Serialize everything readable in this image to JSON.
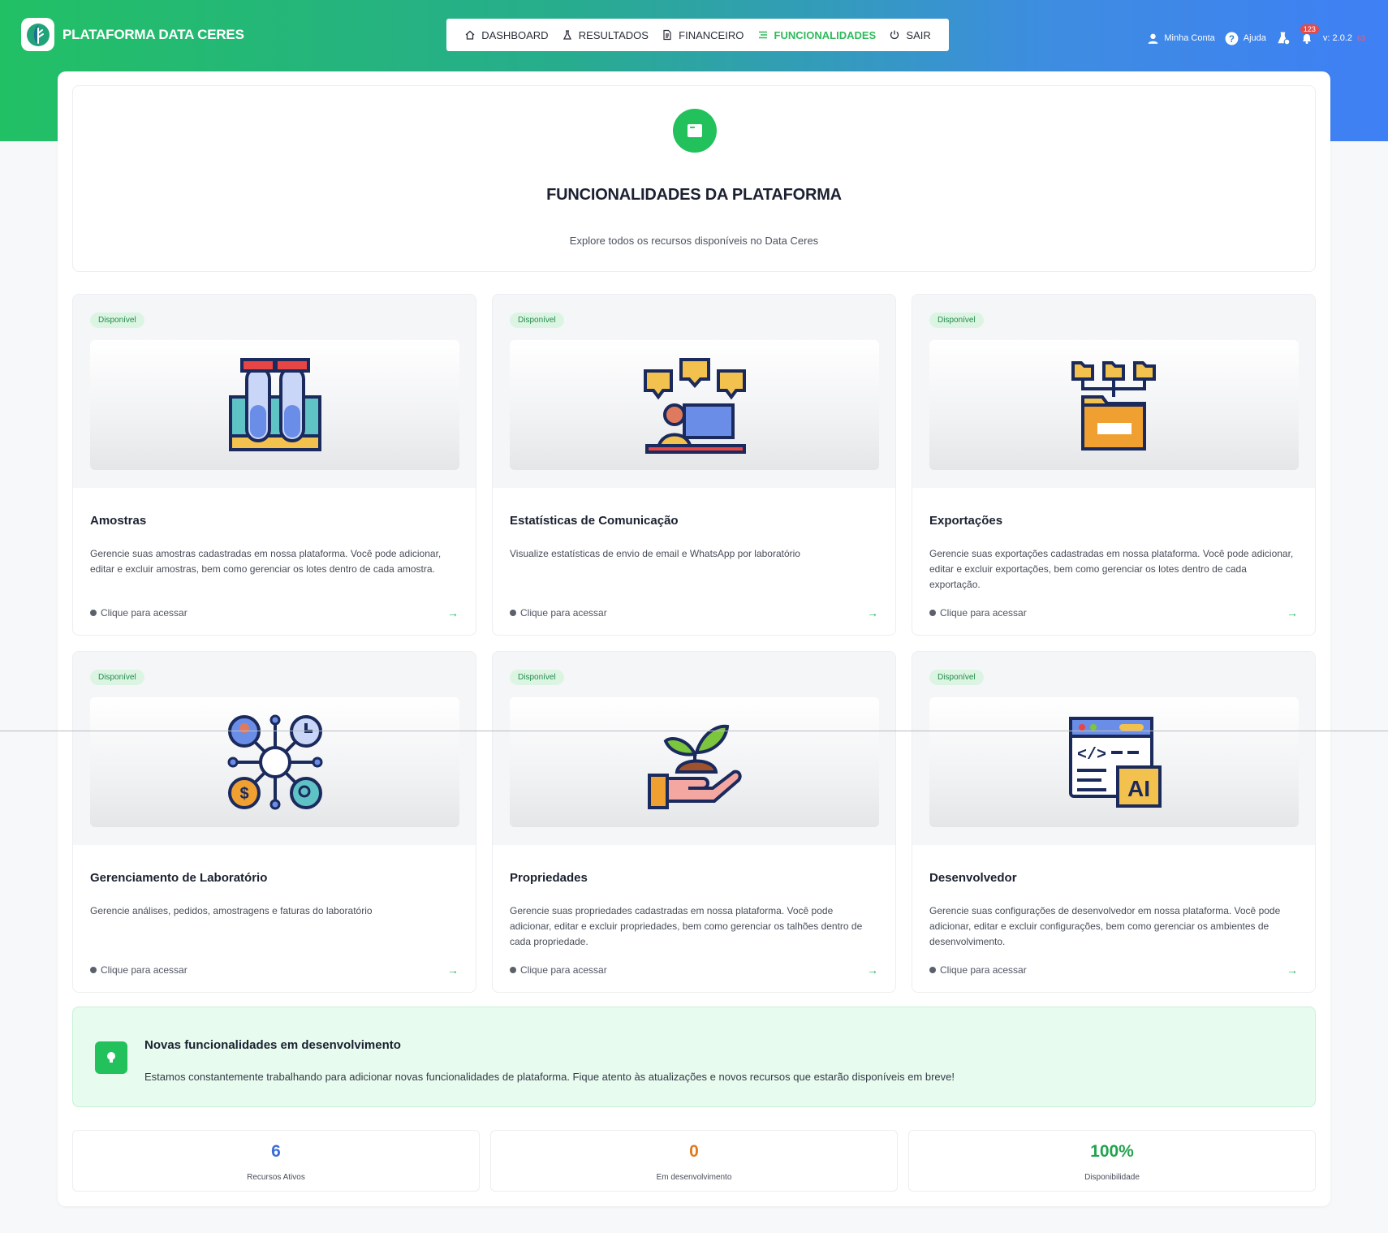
{
  "brand": {
    "name": "PLATAFORMA DATA CERES",
    "logo_icon": "leaf-logo-icon"
  },
  "nav": {
    "items": [
      {
        "label": "DASHBOARD",
        "icon": "home-icon"
      },
      {
        "label": "RESULTADOS",
        "icon": "flask-icon"
      },
      {
        "label": "FINANCEIRO",
        "icon": "document-icon"
      },
      {
        "label": "FUNCIONALIDADES",
        "icon": "list-icon",
        "active": true
      },
      {
        "label": "SAIR",
        "icon": "power-icon"
      }
    ]
  },
  "topbar": {
    "account_label": "Minha Conta",
    "help_label": "Ajuda",
    "notifications_count": "123",
    "version": "v: 2.0.2",
    "version_tag": "63"
  },
  "header": {
    "title": "FUNCIONALIDADES DA PLATAFORMA",
    "subtitle": "Explore todos os recursos disponíveis no Data Ceres"
  },
  "cards": [
    {
      "status": "Disponível",
      "title": "Amostras",
      "description": "Gerencie suas amostras cadastradas em nossa plataforma. Você pode adicionar, editar e excluir amostras, bem como gerenciar os lotes dentro de cada amostra.",
      "cta": "Clique para acessar",
      "illustration": "test-tubes-icon"
    },
    {
      "status": "Disponível",
      "title": "Estatísticas de Comunicação",
      "description": "Visualize estatísticas de envio de email e WhatsApp por laboratório",
      "cta": "Clique para acessar",
      "illustration": "communication-icon"
    },
    {
      "status": "Disponível",
      "title": "Exportações",
      "description": "Gerencie suas exportações cadastradas em nossa plataforma. Você pode adicionar, editar e excluir exportações, bem como gerenciar os lotes dentro de cada exportação.",
      "cta": "Clique para acessar",
      "illustration": "folder-tree-icon"
    },
    {
      "status": "Disponível",
      "title": "Gerenciamento de Laboratório",
      "description": "Gerencie análises, pedidos, amostragens e faturas do laboratório",
      "cta": "Clique para acessar",
      "illustration": "network-hub-icon"
    },
    {
      "status": "Disponível",
      "title": "Propriedades",
      "description": "Gerencie suas propriedades cadastradas em nossa plataforma. Você pode adicionar, editar e excluir propriedades, bem como gerenciar os talhões dentro de cada propriedade.",
      "cta": "Clique para acessar",
      "illustration": "plant-hand-icon"
    },
    {
      "status": "Disponível",
      "title": "Desenvolvedor",
      "description": "Gerencie suas configurações de desenvolvedor em nossa plataforma. Você pode adicionar, editar e excluir configurações, bem como gerenciar os ambientes de desenvolvimento.",
      "cta": "Clique para acessar",
      "illustration": "code-ai-icon"
    }
  ],
  "notice": {
    "title": "Novas funcionalidades em desenvolvimento",
    "text": "Estamos constantemente trabalhando para adicionar novas funcionalidades de plataforma. Fique atento às atualizações e novos recursos que estarão disponíveis em breve!"
  },
  "stats": [
    {
      "value": "6",
      "label": "Recursos Ativos",
      "color": "#3b6fd6"
    },
    {
      "value": "0",
      "label": "Em desenvolvimento",
      "color": "#e07a1f"
    },
    {
      "value": "100%",
      "label": "Disponibilidade",
      "color": "#23a34f"
    }
  ],
  "colors": {
    "brand_green": "#22c15c",
    "brand_blue": "#3f7ff5",
    "active_nav": "#2dba5b"
  }
}
